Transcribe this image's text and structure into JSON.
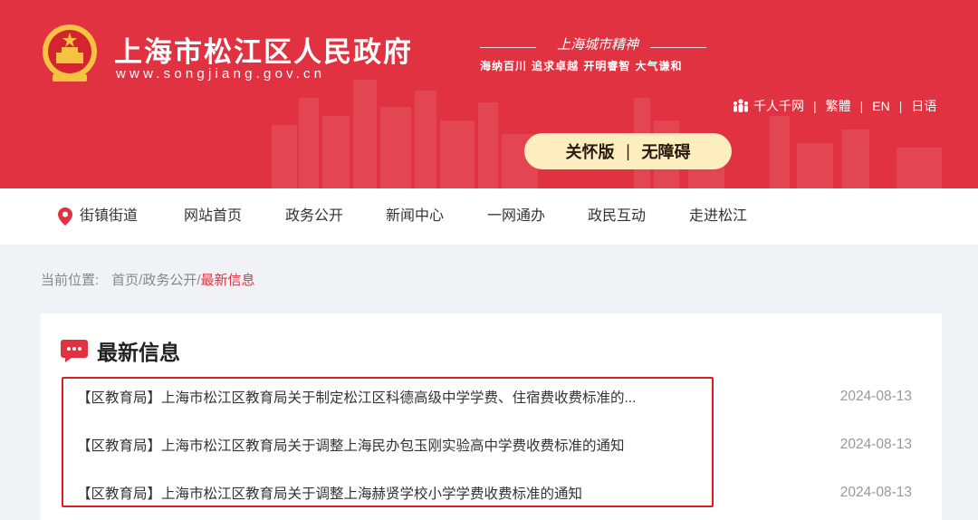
{
  "header": {
    "site_title": "上海市松江区人民政府",
    "site_url": "www.songjiang.gov.cn",
    "spirit_title": "上海城市精神",
    "spirit_slogan": "海纳百川  追求卓越  开明睿智  大气谦和",
    "lang_links": [
      "千人千网",
      "繁體",
      "EN",
      "日语"
    ],
    "care_mode": "关怀版",
    "accessible": "无障碍",
    "colors": {
      "brand_red": "#e03240",
      "pill_bg": "#fdeec0"
    }
  },
  "nav": {
    "location_label": "街镇街道",
    "items": [
      "网站首页",
      "政务公开",
      "新闻中心",
      "一网通办",
      "政民互动",
      "走进松江"
    ]
  },
  "breadcrumb": {
    "label": "当前位置:",
    "path": "首页/政务公开/",
    "current": "最新信息"
  },
  "panel": {
    "title": "最新信息",
    "news": [
      {
        "title": "【区教育局】上海市松江区教育局关于制定松江区科德高级中学学费、住宿费收费标准的...",
        "date": "2024-08-13"
      },
      {
        "title": "【区教育局】上海市松江区教育局关于调整上海民办包玉刚实验高中学费收费标准的通知",
        "date": "2024-08-13"
      },
      {
        "title": "【区教育局】上海市松江区教育局关于调整上海赫贤学校小学学费收费标准的通知",
        "date": "2024-08-13"
      }
    ]
  }
}
